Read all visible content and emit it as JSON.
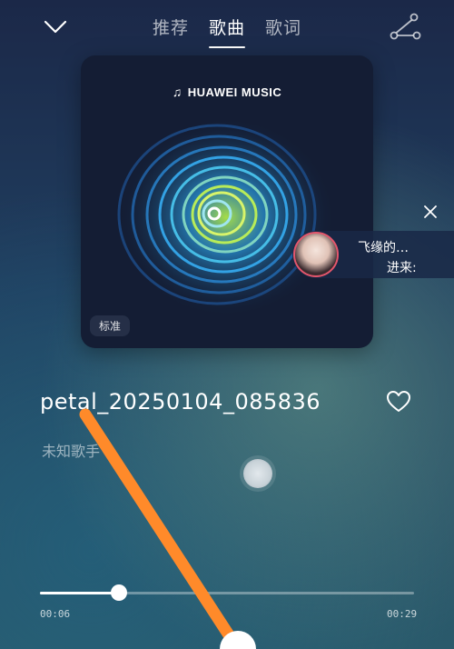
{
  "header": {
    "back_icon": "chevron-down-icon",
    "tabs": [
      {
        "label": "推荐",
        "active": false
      },
      {
        "label": "歌曲",
        "active": true
      },
      {
        "label": "歌词",
        "active": false
      }
    ],
    "share_icon": "share-icon"
  },
  "cover": {
    "brand": "HUAWEI MUSIC",
    "quality_label": "标准"
  },
  "popup": {
    "line1": "飞缘的…",
    "line2": "进来:"
  },
  "song": {
    "title": "petal_20250104_085836",
    "artist": "未知歌手"
  },
  "player": {
    "current_time": "00:06",
    "total_time": "00:29",
    "progress_fraction": 0.21
  },
  "colors": {
    "accent": "#ffffff",
    "annotation": "#ff8a2a"
  }
}
